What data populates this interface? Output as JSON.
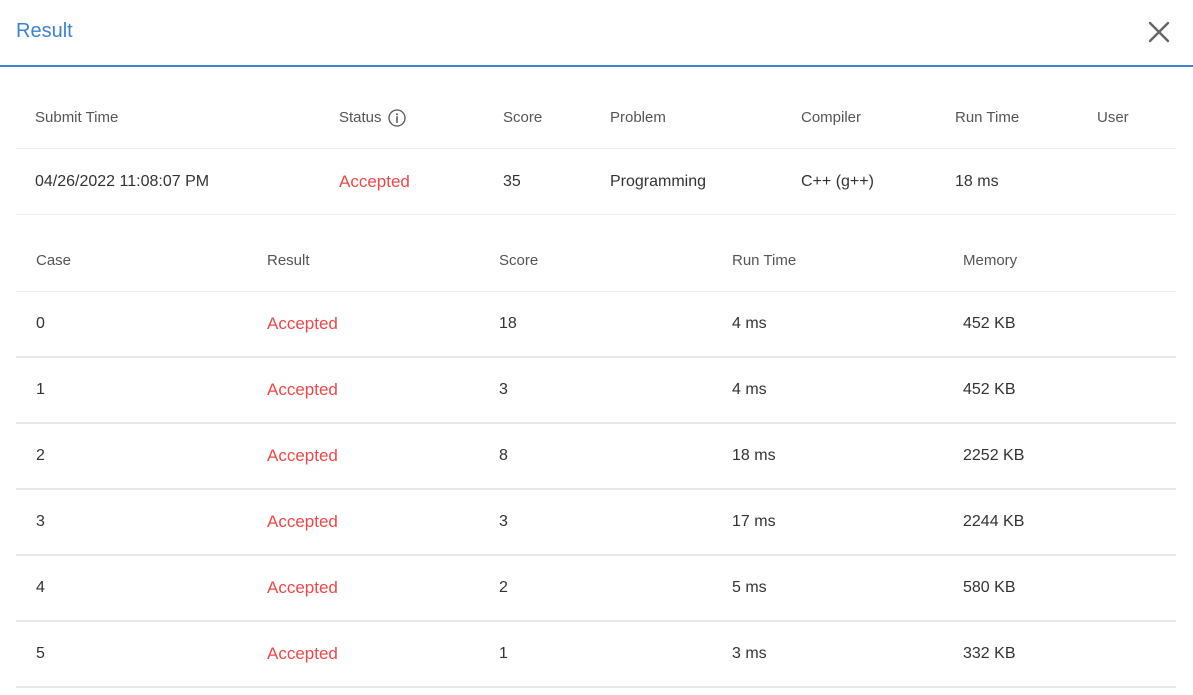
{
  "dialog": {
    "title": "Result"
  },
  "summary": {
    "headers": {
      "submit_time": "Submit Time",
      "status": "Status",
      "score": "Score",
      "problem": "Problem",
      "compiler": "Compiler",
      "run_time": "Run Time",
      "user": "User"
    },
    "row": {
      "submit_time": "04/26/2022 11:08:07 PM",
      "status": "Accepted",
      "score": "35",
      "problem": "Programming",
      "compiler": "C++ (g++)",
      "run_time": "18 ms",
      "user": ""
    }
  },
  "cases": {
    "headers": {
      "case": "Case",
      "result": "Result",
      "score": "Score",
      "run_time": "Run Time",
      "memory": "Memory"
    },
    "rows": [
      {
        "case": "0",
        "result": "Accepted",
        "score": "18",
        "run_time": "4 ms",
        "memory": "452 KB"
      },
      {
        "case": "1",
        "result": "Accepted",
        "score": "3",
        "run_time": "4 ms",
        "memory": "452 KB"
      },
      {
        "case": "2",
        "result": "Accepted",
        "score": "8",
        "run_time": "18 ms",
        "memory": "2252 KB"
      },
      {
        "case": "3",
        "result": "Accepted",
        "score": "3",
        "run_time": "17 ms",
        "memory": "2244 KB"
      },
      {
        "case": "4",
        "result": "Accepted",
        "score": "2",
        "run_time": "5 ms",
        "memory": "580 KB"
      },
      {
        "case": "5",
        "result": "Accepted",
        "score": "1",
        "run_time": "3 ms",
        "memory": "332 KB"
      }
    ]
  },
  "colors": {
    "accent": "#3a83d8",
    "accepted": "#f04848"
  },
  "icons": {
    "close": "close-icon",
    "status_info": "info-icon"
  }
}
